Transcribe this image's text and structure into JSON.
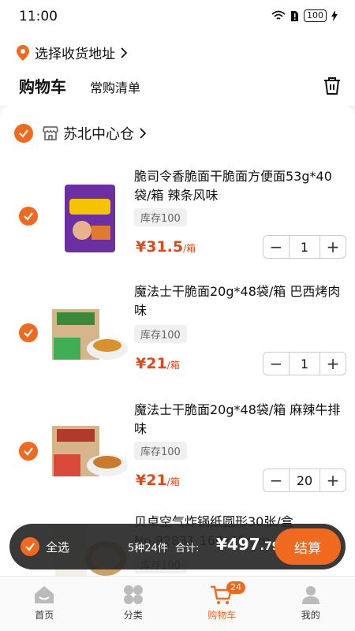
{
  "status_bar": {
    "time": "11:00",
    "battery": "100"
  },
  "header": {
    "address_label": "选择收货地址",
    "tab_cart": "购物车",
    "tab_frequent": "常购清单"
  },
  "store": {
    "name": "苏北中心仓"
  },
  "items": [
    {
      "title": "脆司令香脆面干脆面方便面53g*40袋/箱 辣条风味",
      "stock": "库存100",
      "price_int": "¥31",
      "price_dec": ".5",
      "unit": "/箱",
      "qty": "1"
    },
    {
      "title": "魔法士干脆面20g*48袋/箱 巴西烤肉味",
      "stock": "库存100",
      "price_int": "¥21",
      "price_dec": "",
      "unit": "/箱",
      "qty": "1"
    },
    {
      "title": "魔法士干脆面20g*48袋/箱 麻辣牛排味",
      "stock": "库存100",
      "price_int": "¥21",
      "price_dec": "",
      "unit": "/箱",
      "qty": "20"
    },
    {
      "title": "贝卓空气炸锅纸圆形30张/盒 No.92831 160*45mm",
      "stock": "库存100",
      "price_int": "",
      "price_dec": "",
      "unit": "",
      "qty": ""
    }
  ],
  "checkout": {
    "select_all": "全选",
    "summary": "5种24件",
    "total_label": "合计:",
    "total_int": "¥497",
    "total_dec": ".79",
    "pay_button": "结算"
  },
  "tabbar": [
    {
      "label": "首页",
      "icon": "home-icon"
    },
    {
      "label": "分类",
      "icon": "category-icon"
    },
    {
      "label": "购物车",
      "icon": "cart-icon",
      "badge": "24"
    },
    {
      "label": "我的",
      "icon": "profile-icon"
    }
  ],
  "colors": {
    "accent": "#ef6a1f",
    "price": "#e04a1a"
  }
}
